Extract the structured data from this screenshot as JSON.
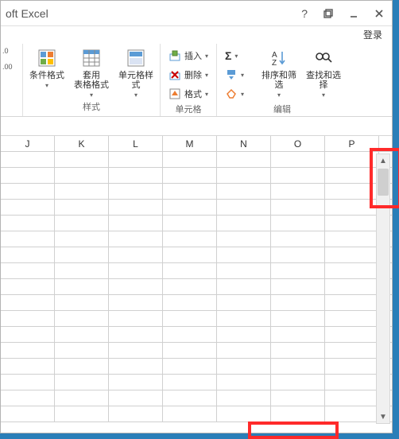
{
  "titlebar": {
    "title": "oft Excel",
    "help": "?"
  },
  "login": {
    "label": "登录"
  },
  "ribbon": {
    "numfmt": {
      "inc": ".0",
      "dec": ".00"
    },
    "cond_format": "条件格式",
    "table_format": "套用\n表格格式",
    "cell_style": "单元格样式",
    "group_styles": "样式",
    "insert": "插入",
    "delete": "删除",
    "format": "格式",
    "group_cells": "单元格",
    "autosum": "Σ",
    "fill": "↓",
    "clear": "◇",
    "sort": "排序和筛选",
    "find": "查找和选择",
    "group_edit": "编辑"
  },
  "columns": [
    "J",
    "K",
    "L",
    "M",
    "N",
    "O",
    "P"
  ]
}
